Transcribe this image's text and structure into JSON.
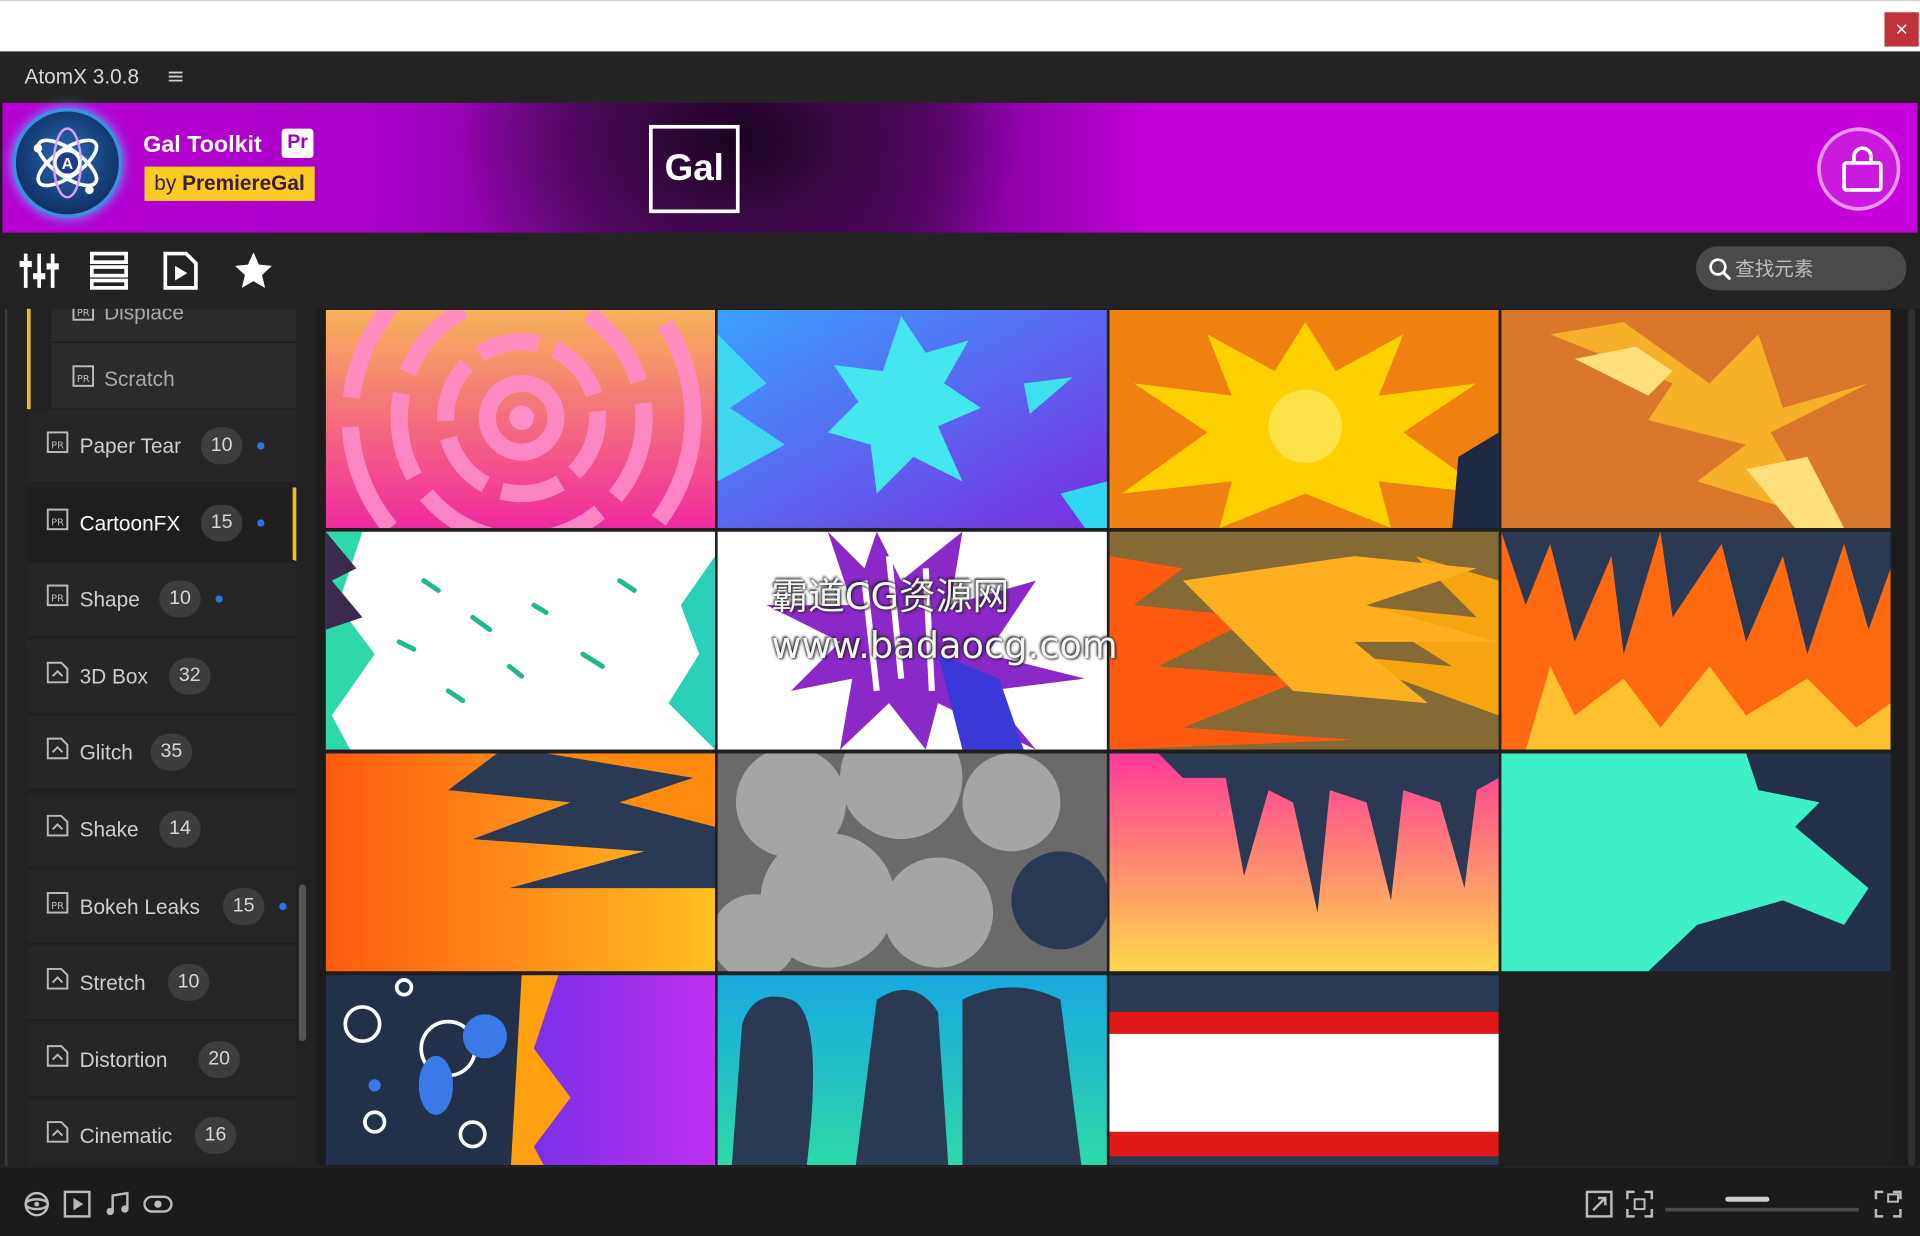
{
  "window": {
    "close_glyph": "×"
  },
  "app": {
    "title": "AtomX 3.0.8",
    "menu_glyph": "≡"
  },
  "banner": {
    "brand": "Gal Toolkit",
    "pr_badge": "Pr",
    "by_prefix": "by ",
    "author": "PremiereGal",
    "center_logo": "Gal",
    "accent_color": "#d000e4",
    "cart_icon": "shopping-bag-icon"
  },
  "toolbar": {
    "tools": [
      "sliders-icon",
      "list-icon",
      "media-icon",
      "star-icon"
    ],
    "search_placeholder": "查找元素"
  },
  "sidebar": {
    "sub_items": [
      {
        "label": "Displace"
      },
      {
        "label": "Scratch"
      }
    ],
    "items": [
      {
        "label": "Paper Tear",
        "count": "10",
        "type": "pr",
        "new": true
      },
      {
        "label": "CartoonFX",
        "count": "15",
        "type": "pr",
        "new": true,
        "active": true
      },
      {
        "label": "Shape",
        "count": "10",
        "type": "pr",
        "new": true
      },
      {
        "label": "3D Box",
        "count": "32",
        "type": "preset",
        "new": false
      },
      {
        "label": "Glitch",
        "count": "35",
        "type": "preset",
        "new": false
      },
      {
        "label": "Shake",
        "count": "14",
        "type": "preset",
        "new": false
      },
      {
        "label": "Bokeh Leaks",
        "count": "15",
        "type": "pr",
        "new": true
      },
      {
        "label": "Stretch",
        "count": "10",
        "type": "preset",
        "new": false
      },
      {
        "label": "Distortion",
        "count": "20",
        "type": "preset",
        "new": false
      },
      {
        "label": "Cinematic",
        "count": "16",
        "type": "preset",
        "new": false
      }
    ]
  },
  "grid": {
    "tiles": [
      "pink-flower-burst",
      "blue-splash",
      "yellow-explosion",
      "orange-flare",
      "white-speed-lines",
      "purple-splatter",
      "orange-flames-left",
      "fire-flames",
      "orange-fire-wave",
      "grey-smoke",
      "pink-drips",
      "teal-liquid",
      "bubbles-transition",
      "teal-silhouettes",
      "red-white-stripes"
    ]
  },
  "watermark": {
    "line1": "霸道CG资源网",
    "line2": "www.badaocg.com"
  },
  "bottombar": {
    "left_icons": [
      "rotate-3d-icon",
      "play-box-icon",
      "music-note-icon",
      "eye-icon"
    ],
    "right_icons": [
      "expand-icon",
      "fit-icon",
      "fullscreen-icon"
    ],
    "zoom_level": 0.4
  }
}
